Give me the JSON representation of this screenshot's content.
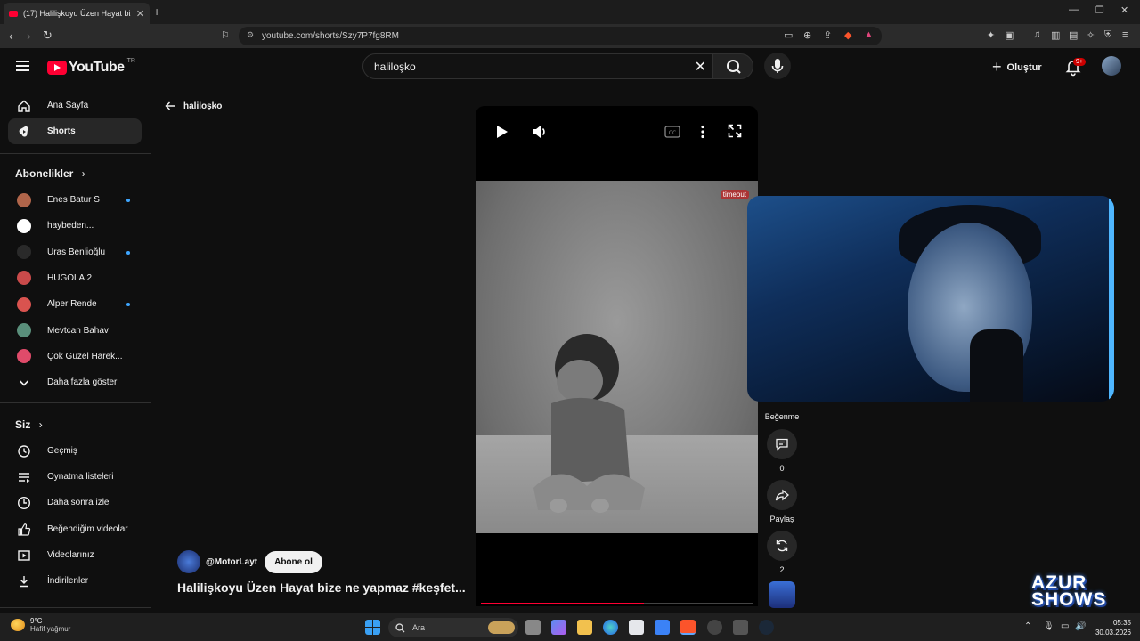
{
  "browser": {
    "tab_title": "(17) Halilişkoyu Üzen Hayat bize ne yapmaz",
    "url": "youtube.com/shorts/Szy7P7fg8RM"
  },
  "header": {
    "logo_text": "YouTube",
    "region": "TR",
    "search_value": "haliloşko",
    "create_label": "Oluştur",
    "notif_count": "9+"
  },
  "sidebar": {
    "home": "Ana Sayfa",
    "shorts": "Shorts",
    "subs_heading": "Abonelikler",
    "channels": [
      {
        "name": "Enes Batur S",
        "dot": true,
        "color": "#b0654a"
      },
      {
        "name": "haybeden...",
        "dot": false,
        "color": "#ffffff"
      },
      {
        "name": "Uras Benlioğlu",
        "dot": true,
        "color": "#2a2a2a"
      },
      {
        "name": "HUGOLA 2",
        "dot": false,
        "color": "#c94a4a"
      },
      {
        "name": "Alper Rende",
        "dot": true,
        "color": "#d9534f"
      },
      {
        "name": "Mevtcan Bahav",
        "dot": false,
        "color": "#5a8f7b"
      },
      {
        "name": "Çok Güzel Harek...",
        "dot": false,
        "color": "#e04b6a"
      }
    ],
    "show_more": "Daha fazla göster",
    "you_heading": "Siz",
    "you_items": [
      "Geçmiş",
      "Oynatma listeleri",
      "Daha sonra izle",
      "Beğendiğim videolar",
      "Videolarınız",
      "İndirilenler"
    ]
  },
  "main": {
    "back_label": "haliloşko",
    "watermark": "timeout",
    "channel": "@MotorLayt",
    "subscribe": "Abone ol",
    "title": "Halilişkoyu Üzen Hayat bize ne yapmaz #keşfet...",
    "actions": {
      "dislike_label": "Beğenme",
      "comments_count": "0",
      "share_label": "Paylaş",
      "remix_count": "2"
    }
  },
  "overlay": {
    "brand_line1": "AZUR",
    "brand_line2": "SHOWS"
  },
  "taskbar": {
    "temp": "9°C",
    "weather": "Hafif yağmur",
    "search_placeholder": "Ara",
    "time": "05:35",
    "date": "30.03.2026"
  },
  "colors": {
    "brand_red": "#ff0033",
    "badge_blue": "#3ea6ff"
  }
}
